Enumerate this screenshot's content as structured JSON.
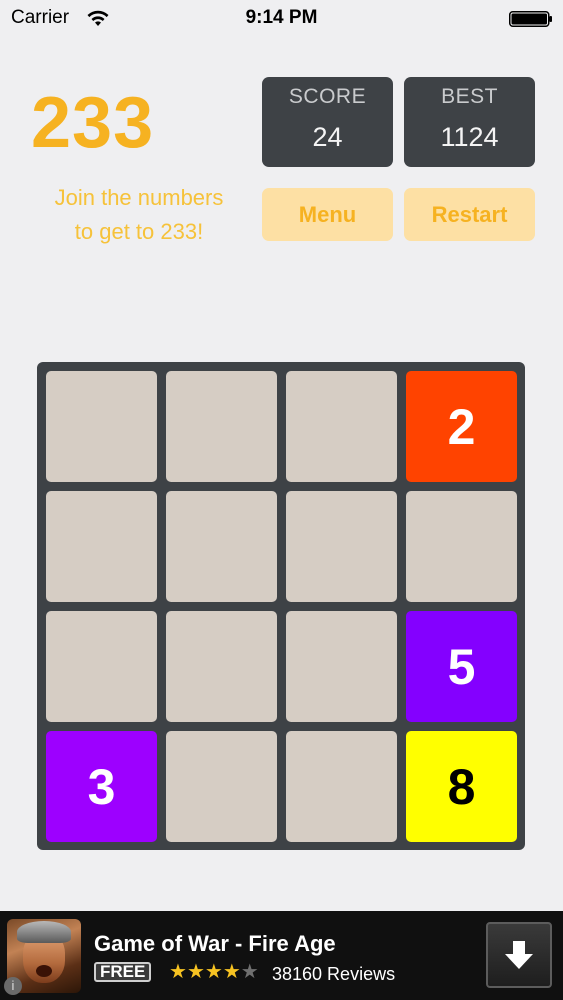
{
  "status_bar": {
    "carrier": "Carrier",
    "time": "9:14 PM"
  },
  "header": {
    "title": "233",
    "tagline_line1": "Join the numbers",
    "tagline_line2": "to get to 233!"
  },
  "scores": {
    "score_label": "SCORE",
    "score_value": "24",
    "best_label": "BEST",
    "best_value": "1124"
  },
  "buttons": {
    "menu_label": "Menu",
    "restart_label": "Restart"
  },
  "board": {
    "rows": 4,
    "cols": 4,
    "tiles": [
      [
        "",
        "",
        "",
        "2"
      ],
      [
        "",
        "",
        "",
        ""
      ],
      [
        "",
        "",
        "",
        "5"
      ],
      [
        "3",
        "",
        "",
        "8"
      ]
    ],
    "tile_colors": {
      "empty": "#d6cdc4",
      "2": "#ff4300",
      "3": "#9d00ff",
      "5": "#8400ff",
      "8": "#ffff00"
    },
    "tile_text_colors": {
      "2": "#ffffff",
      "3": "#ffffff",
      "5": "#ffffff",
      "8": "#000000"
    }
  },
  "ad": {
    "app_name": "Game of War - Fire Age",
    "price_badge": "FREE",
    "rating_stars": 4,
    "max_stars": 5,
    "reviews": "38160 Reviews",
    "icons": {
      "download": "download-arrow-icon",
      "info": "info-icon"
    }
  },
  "colors": {
    "accent": "#f6b221",
    "panel": "#3e4246",
    "button_bg": "#fde0a4",
    "background": "#efeff1"
  }
}
